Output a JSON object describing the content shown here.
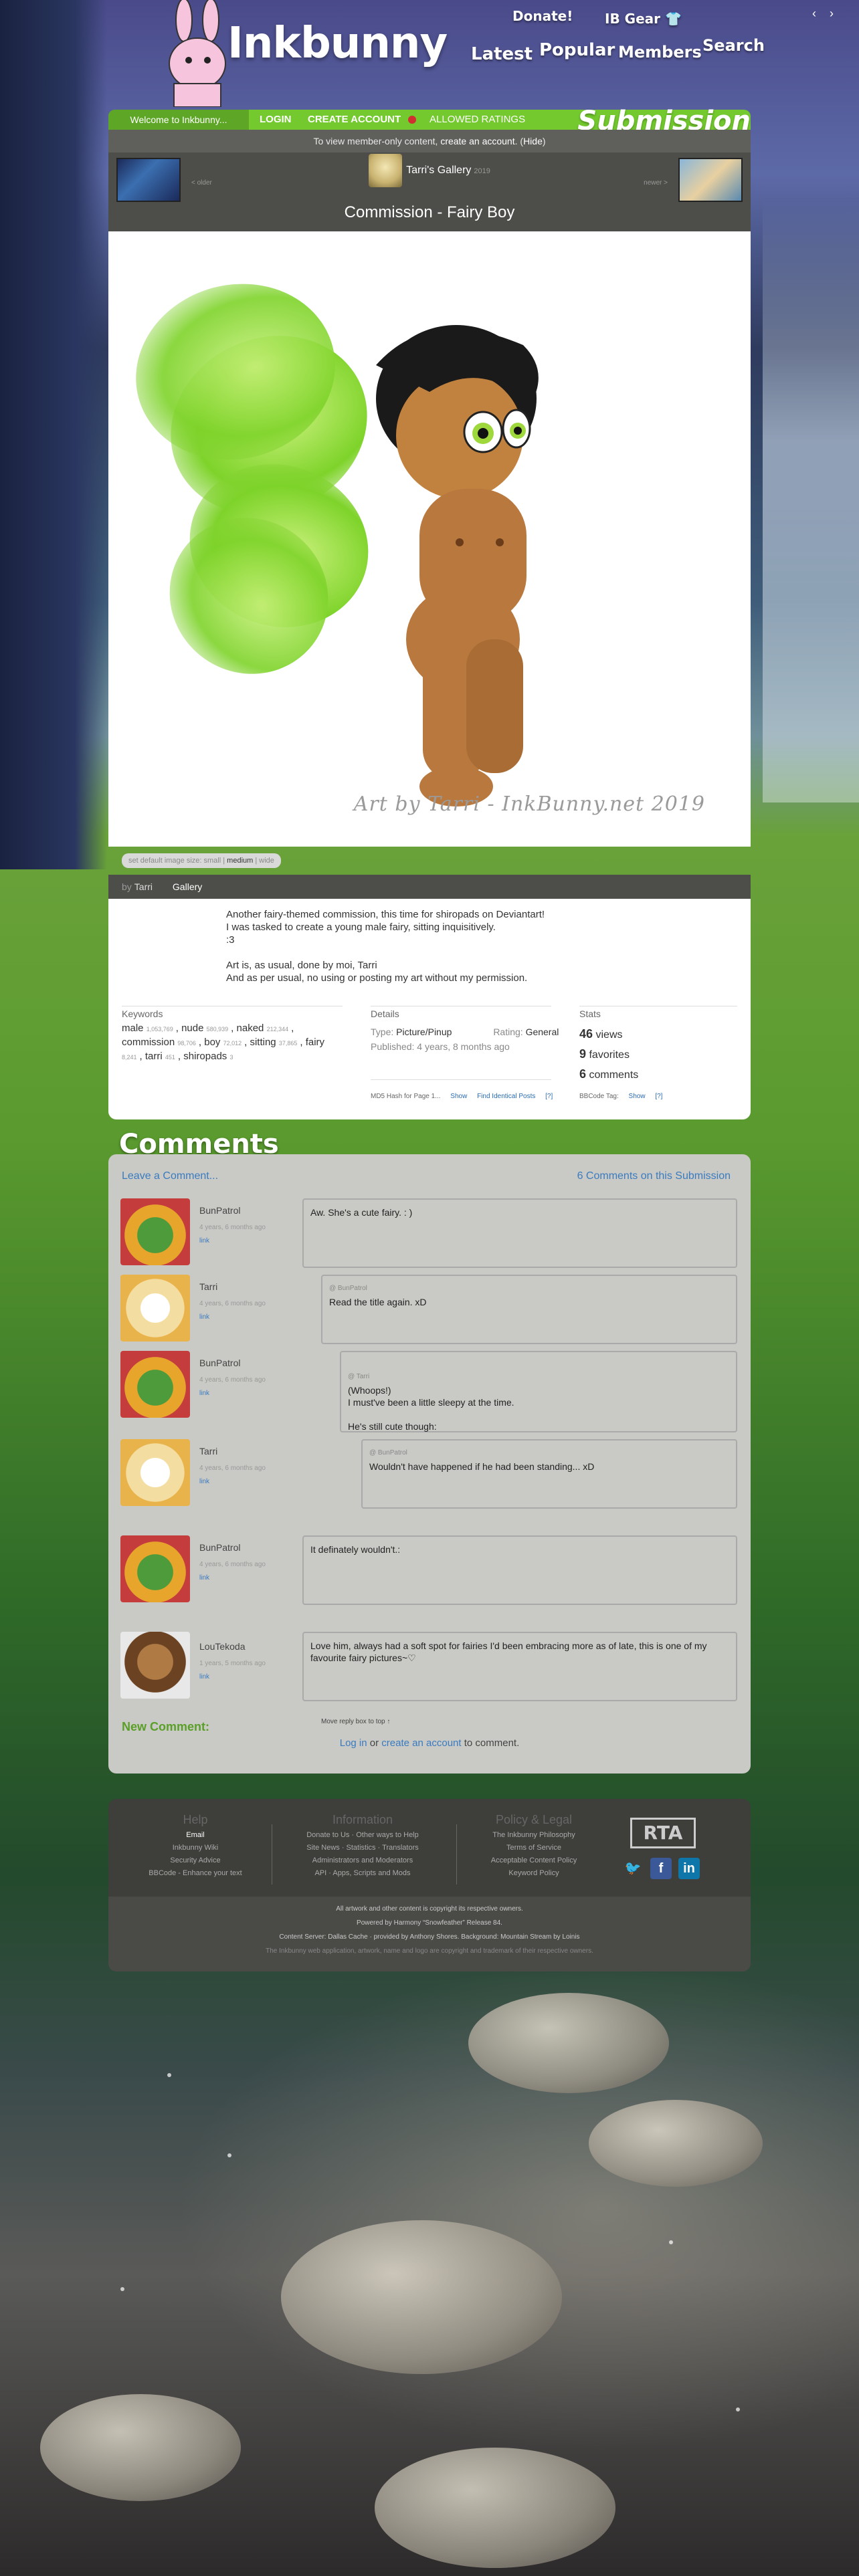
{
  "header": {
    "logo": "Inkbunny",
    "nav": {
      "donate": "Donate!",
      "ib_gear": "IB Gear",
      "latest": "Latest",
      "popular": "Popular",
      "members": "Members",
      "search": "Search"
    }
  },
  "bar": {
    "welcome": "Welcome to Inkbunny...",
    "login": "LOGIN",
    "create": "CREATE ACCOUNT",
    "ratings": "ALLOWED RATINGS",
    "title": "Submission"
  },
  "notice": {
    "prefix": "To view member-only content,",
    "link": "create an account",
    "suffix": ". (",
    "hide": "Hide",
    "end": ")"
  },
  "submission": {
    "gallery": "Tarri's Gallery",
    "gallery_year": "2019",
    "title": "Commission - Fairy Boy",
    "prev_label": "< older",
    "next_label": "newer >",
    "watermark": "Art by Tarri - InkBunny.net 2019",
    "sizes": {
      "prefix": "set default image size:",
      "small": "small",
      "medium": "medium",
      "wide": "wide"
    },
    "by": "by",
    "author": "Tarri",
    "tab_gallery": "Gallery"
  },
  "description": {
    "lines": [
      "Another fairy-themed commission, this time for shiropads on Deviantart!",
      "I was tasked to create a young male fairy, sitting inquisitively.",
      ":3",
      "Art is, as usual, done by moi, Tarri",
      "And as per usual, no using or posting my art without my permission."
    ]
  },
  "keywords": {
    "heading": "Keywords",
    "items": [
      {
        "tag": "male",
        "count": "1,053,769"
      },
      {
        "tag": "nude",
        "count": "580,939"
      },
      {
        "tag": "naked",
        "count": "212,344"
      },
      {
        "tag": "commission",
        "count": "98,706"
      },
      {
        "tag": "boy",
        "count": "72,012"
      },
      {
        "tag": "sitting",
        "count": "37,865"
      },
      {
        "tag": "fairy",
        "count": "8,241"
      },
      {
        "tag": "tarri",
        "count": "451"
      },
      {
        "tag": "shiropads",
        "count": "3"
      }
    ]
  },
  "details": {
    "heading": "Details",
    "type_label": "Type:",
    "type": "Picture/Pinup",
    "rating_label": "Rating:",
    "rating": "General",
    "published_label": "Published:",
    "published": "4 years, 8 months ago",
    "md5_label": "MD5 Hash for Page 1...",
    "md5_show": "Show",
    "md5_find": "Find Identical Posts",
    "md5_help": "[?]"
  },
  "stats": {
    "heading": "Stats",
    "views": "46",
    "views_label": "views",
    "favorites": "9",
    "favorites_label": "favorites",
    "comments": "6",
    "comments_label": "comments",
    "bbcode_label": "BBCode Tag:",
    "bbcode_show": "Show",
    "bbcode_help": "[?]"
  },
  "comments": {
    "title": "Comments",
    "leave": "Leave a Comment...",
    "count": "6 Comments on this Submission",
    "link_label": "link",
    "list": [
      {
        "user": "BunPatrol",
        "time": "4 years, 6 months ago",
        "reply_to": "",
        "text": "Aw. She's a cute fairy. : )"
      },
      {
        "user": "Tarri",
        "time": "4 years, 6 months ago",
        "reply_to": "@ BunPatrol",
        "text": "Read the title again. xD"
      },
      {
        "user": "BunPatrol",
        "time": "4 years, 6 months ago",
        "reply_to": "@ Tarri",
        "text": "(Whoops!)\nI must've been a little sleepy at the time.\n\nHe's still cute though:"
      },
      {
        "user": "Tarri",
        "time": "4 years, 6 months ago",
        "reply_to": "@ BunPatrol",
        "text": "Wouldn't have happened if he had been standing... xD"
      },
      {
        "user": "BunPatrol",
        "time": "4 years, 6 months ago",
        "reply_to": "",
        "text": "It definately wouldn't.:"
      },
      {
        "user": "LouTekoda",
        "time": "1 years, 5 months ago",
        "reply_to": "",
        "text": "Love him, always had a soft spot for fairies I'd been embracing more as of late, this is one of my favourite fairy pictures~♡"
      }
    ],
    "new_comment": "New Comment:",
    "move_reply": "Move reply box to top ↑",
    "login_link": "Log in",
    "or": "or",
    "create_link": "create an account",
    "to_comment": "to comment."
  },
  "footer": {
    "help": {
      "heading": "Help",
      "items": [
        "Email",
        "Inkbunny Wiki",
        "Security Advice",
        "BBCode - Enhance your text"
      ]
    },
    "information": {
      "heading": "Information",
      "items": [
        "Donate to Us · Other ways to Help",
        "Site News · Statistics · Translators",
        "Administrators and Moderators",
        "API · Apps, Scripts and Mods"
      ]
    },
    "policy": {
      "heading": "Policy & Legal",
      "items": [
        "The Inkbunny Philosophy",
        "Terms of Service",
        "Acceptable Content Policy",
        "Keyword Policy"
      ]
    },
    "rta": "RTA",
    "copyright": "All artwork and other content is copyright its respective owners.",
    "powered": "Powered by Harmony “Snowfeather” Release 84.",
    "server": "Content Server: Dallas Cache · provided by Anthony Shores. Background: Mountain Stream by Loinis",
    "trademark": "The Inkbunny web application, artwork, name and logo are copyright and trademark of their respective owners."
  },
  "colors": {
    "green": "#73c92e",
    "link": "#3a7bc0",
    "panel_dark": "#4d4d49",
    "comment_bg": "#c9c9c5"
  }
}
